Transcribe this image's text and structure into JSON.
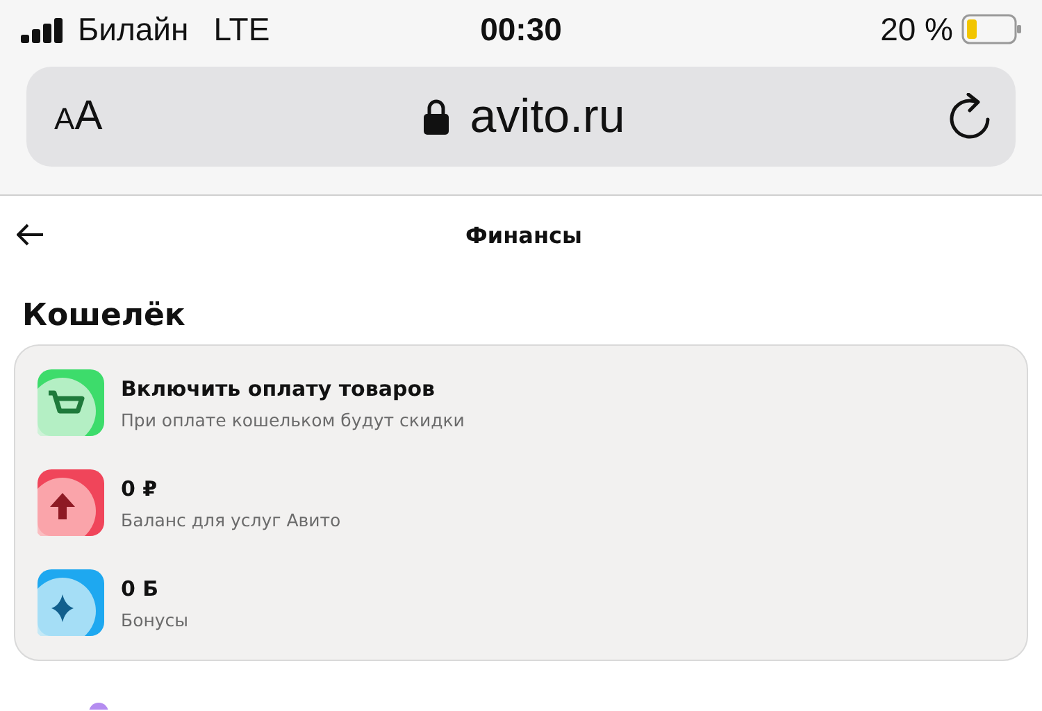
{
  "status_bar": {
    "carrier": "Билайн",
    "network": "LTE",
    "time": "00:30",
    "battery": "20 %"
  },
  "address_bar": {
    "text_size": "AA",
    "url": "avito.ru"
  },
  "header": {
    "title": "Финансы"
  },
  "wallet": {
    "title": "Кошелёк",
    "items": [
      {
        "kind": "cart",
        "title": "Включить оплату товаров",
        "subtitle": "При оплате кошельком будут скидки"
      },
      {
        "kind": "arrow",
        "title": "0 ₽",
        "subtitle": "Баланс для услуг Авито"
      },
      {
        "kind": "star",
        "title": "0 Б",
        "subtitle": "Бонусы"
      }
    ]
  }
}
